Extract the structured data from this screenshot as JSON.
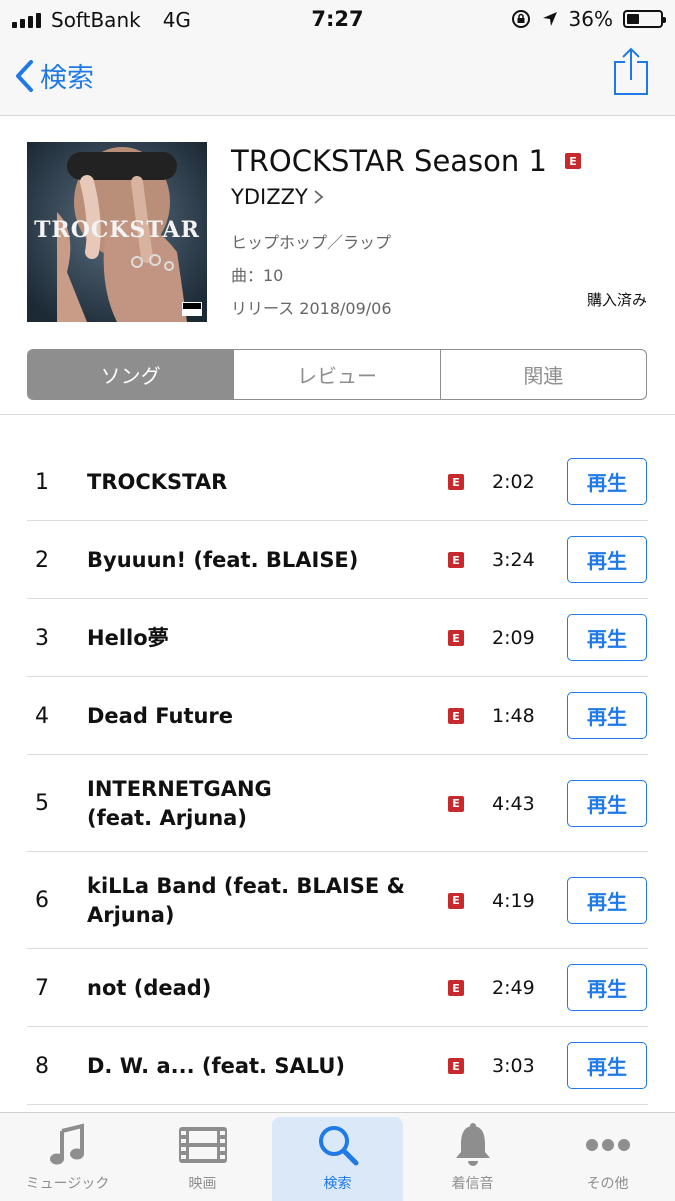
{
  "status_bar": {
    "carrier": "SoftBank",
    "network": "4G",
    "time": "7:27",
    "battery": "36%",
    "battery_level": 0.36
  },
  "nav": {
    "back_label": "検索"
  },
  "album": {
    "title": "TROCKSTAR Season 1",
    "explicit_badge": "E",
    "artist": "YDIZZY",
    "genre": "ヒップホップ／ラップ",
    "track_count": "曲：10",
    "release": "リリース 2018/09/06",
    "purchased": "購入済み",
    "artwork_text": "TROCKSTAR"
  },
  "segments": [
    "ソング",
    "レビュー",
    "関連"
  ],
  "tracks": [
    {
      "num": "1",
      "title": "TROCKSTAR",
      "explicit": "E",
      "duration": "2:02",
      "action": "再生"
    },
    {
      "num": "2",
      "title": "Byuuun! (feat. BLAISE)",
      "explicit": "E",
      "duration": "3:24",
      "action": "再生"
    },
    {
      "num": "3",
      "title": "Hello夢",
      "explicit": "E",
      "duration": "2:09",
      "action": "再生"
    },
    {
      "num": "4",
      "title": "Dead Future",
      "explicit": "E",
      "duration": "1:48",
      "action": "再生"
    },
    {
      "num": "5",
      "title": "INTERNETGANG (feat. Arjuna)",
      "explicit": "E",
      "duration": "4:43",
      "action": "再生"
    },
    {
      "num": "6",
      "title": "kiLLa Band (feat. BLAISE & Arjuna)",
      "explicit": "E",
      "duration": "4:19",
      "action": "再生"
    },
    {
      "num": "7",
      "title": "not (dead)",
      "explicit": "E",
      "duration": "2:49",
      "action": "再生"
    },
    {
      "num": "8",
      "title": "D. W. a... (feat. SALU)",
      "explicit": "E",
      "duration": "3:03",
      "action": "再生"
    }
  ],
  "tabs": [
    {
      "label": "ミュージック",
      "icon": "music-note-icon"
    },
    {
      "label": "映画",
      "icon": "film-icon"
    },
    {
      "label": "検索",
      "icon": "search-icon"
    },
    {
      "label": "着信音",
      "icon": "bell-icon"
    },
    {
      "label": "その他",
      "icon": "more-icon"
    }
  ],
  "colors": {
    "accent": "#1f7ae6",
    "explicit": "#c8292c",
    "segment_selected": "#8e8e8e"
  }
}
